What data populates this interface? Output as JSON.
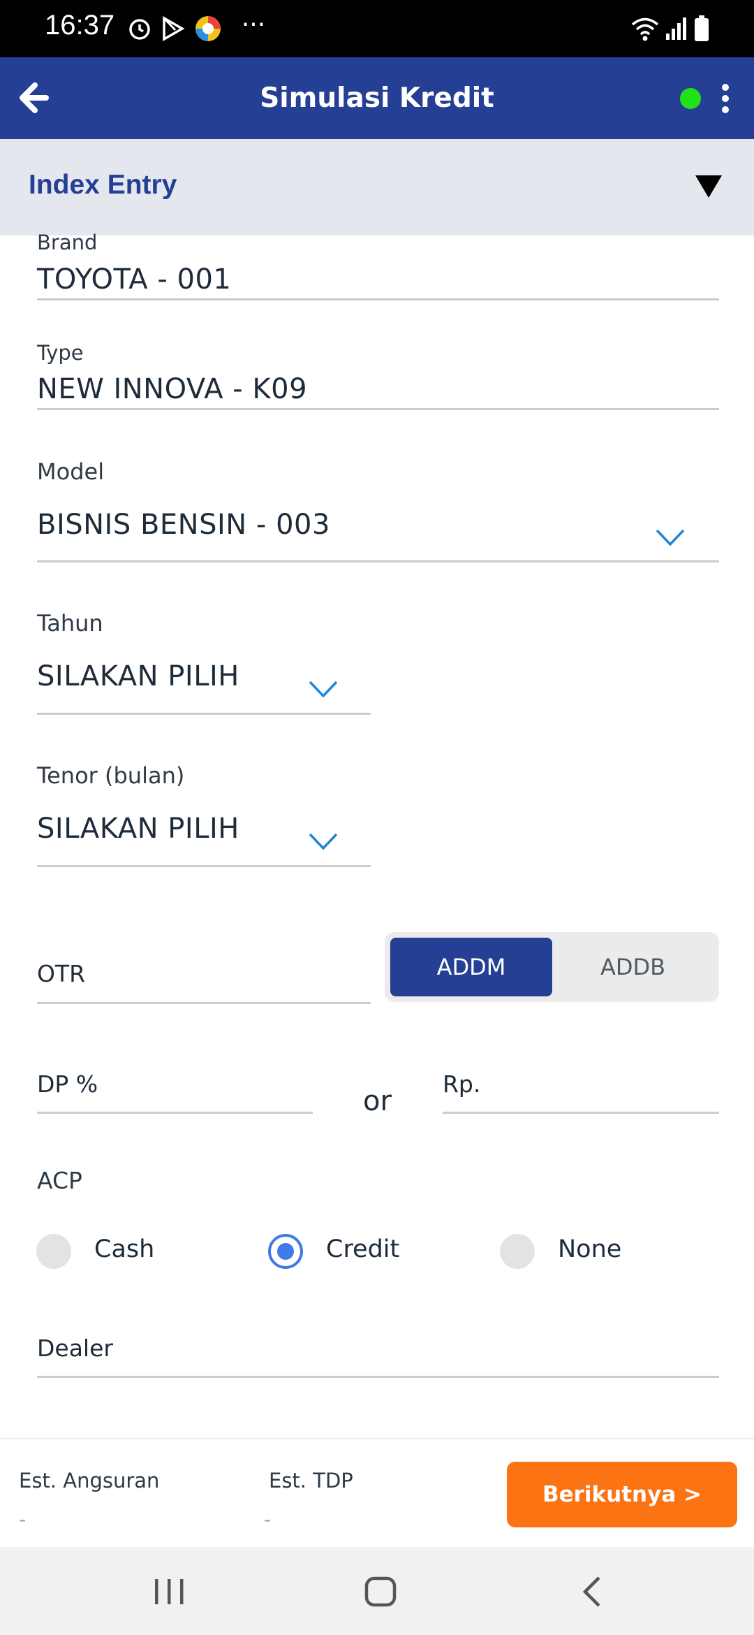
{
  "status_bar": {
    "time": "16:37",
    "more": "···"
  },
  "app_bar": {
    "title": "Simulasi Kredit",
    "status_color": "#22e01a"
  },
  "section": {
    "title": "Index Entry"
  },
  "form": {
    "brand": {
      "label": "Brand",
      "value": "TOYOTA - 001"
    },
    "type": {
      "label": "Type",
      "value": "NEW INNOVA - K09"
    },
    "model": {
      "label": "Model",
      "value": "BISNIS BENSIN - 003"
    },
    "tahun": {
      "label": "Tahun",
      "value": "SILAKAN PILIH"
    },
    "tenor": {
      "label": "Tenor (bulan)",
      "value": "SILAKAN PILIH"
    },
    "otr": {
      "label": "OTR"
    },
    "toggle": {
      "options": [
        "ADDM",
        "ADDB"
      ],
      "selected": "ADDM"
    },
    "dp_percent": {
      "label": "DP %"
    },
    "or_text": "or",
    "dp_rp": {
      "label": "Rp."
    },
    "acp": {
      "label": "ACP",
      "options": [
        "Cash",
        "Credit",
        "None"
      ],
      "selected": "Credit"
    },
    "dealer": {
      "label": "Dealer"
    }
  },
  "summary": {
    "est_angsuran": {
      "label": "Est. Angsuran",
      "value": "-"
    },
    "est_tdp": {
      "label": "Est. TDP",
      "value": "-"
    },
    "next_button": "Berikutnya >"
  },
  "colors": {
    "primary": "#243f93",
    "accent": "#fb7312",
    "radio": "#3f7ae6",
    "chevron": "#1f86d6"
  }
}
